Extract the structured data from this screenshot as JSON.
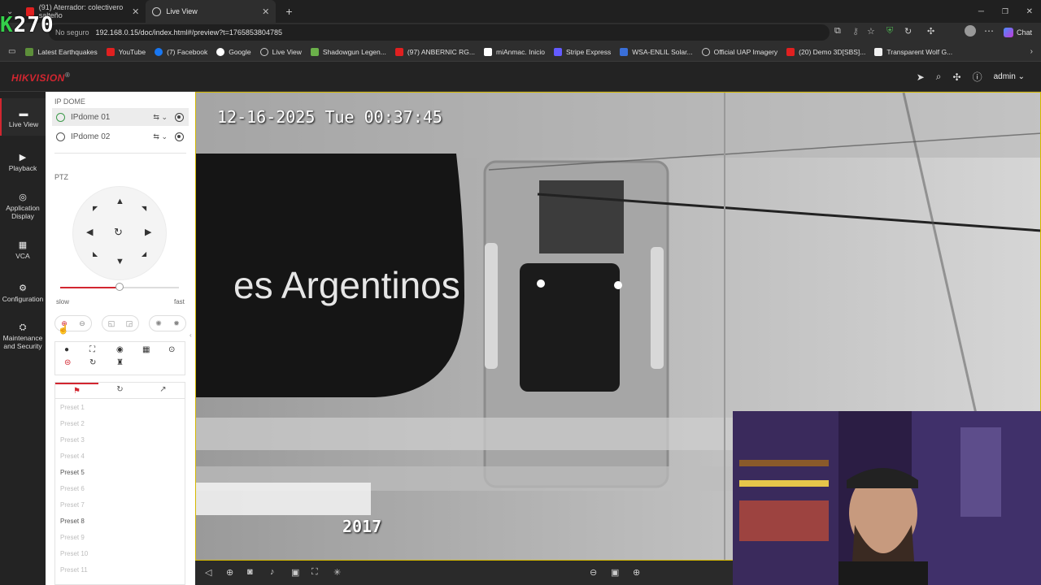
{
  "overlay": {
    "counter_prefix": "K",
    "counter_value": "270"
  },
  "browser": {
    "tabs": [
      {
        "label": "(91) Aterrador: colectivero salteño"
      },
      {
        "label": "Live View"
      }
    ],
    "url_prefix": "No seguro",
    "url": "192.168.0.15/doc/index.html#/preview?t=1765853804785",
    "bookmarks": [
      "Latest Earthquakes",
      "YouTube",
      "(7) Facebook",
      "Google",
      "Live View",
      "Shadowgun Legen...",
      "(97) ANBERNIC RG...",
      "miAnmac. Inicio",
      "Stripe Express",
      "WSA-ENLIL Solar...",
      "Official UAP Imagery",
      "(20) Demo 3D[SBS]...",
      "Transparent Wolf G..."
    ],
    "chat_label": "Chat"
  },
  "app": {
    "logo": "HIKVISION",
    "logo_mark": "®",
    "user": "admin"
  },
  "nav": [
    {
      "label": "Live View",
      "icon": "live-view-icon"
    },
    {
      "label": "Playback",
      "icon": "playback-icon"
    },
    {
      "label": "Application Display",
      "icon": "application-icon"
    },
    {
      "label": "VCA",
      "icon": "vca-icon"
    },
    {
      "label": "Configuration",
      "icon": "gear-icon"
    },
    {
      "label": "Maintenance and Security",
      "icon": "maintenance-icon"
    }
  ],
  "panel": {
    "group_title": "IP DOME",
    "cameras": [
      {
        "name": "IPdome 01"
      },
      {
        "name": "IPdome 02"
      }
    ],
    "ptz_title": "PTZ",
    "speed": {
      "slow": "slow",
      "fast": "fast",
      "level": 0.5
    },
    "presets": [
      "Preset 1",
      "Preset 2",
      "Preset 3",
      "Preset 4",
      "Preset 5",
      "Preset 6",
      "Preset 7",
      "Preset 8",
      "Preset 9",
      "Preset 10",
      "Preset 11"
    ]
  },
  "video": {
    "osd_datetime": "12-16-2025 Tue 00:37:45",
    "overlay_year": "2017",
    "scene_text": "es Argentinos"
  }
}
